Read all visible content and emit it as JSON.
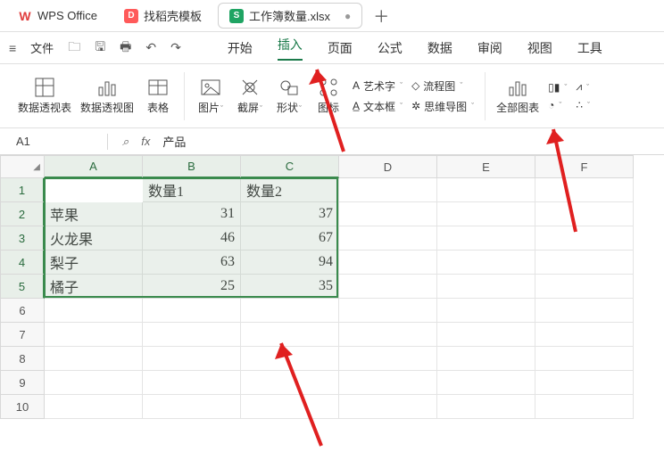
{
  "titlebar": {
    "app_name": "WPS Office",
    "template_tab": "找稻壳模板",
    "doc_tab": "工作簿数量.xlsx",
    "close_glyph": "●",
    "add_glyph": "＋"
  },
  "menurow": {
    "hamburger": "≡",
    "file_label": "文件",
    "icons": {
      "folder": "🗀",
      "save": "🖫",
      "print": "🖶",
      "undo": "↶",
      "redo": "↷"
    },
    "tabs": [
      "开始",
      "插入",
      "页面",
      "公式",
      "数据",
      "审阅",
      "视图",
      "工具"
    ],
    "active_tab": "插入"
  },
  "ribbon": {
    "pivot_table": "数据透视表",
    "pivot_chart": "数据透视图",
    "table": "表格",
    "picture": "图片",
    "screenshot": "截屏",
    "shapes": "形状",
    "iconlib": "图标",
    "wordart": "艺术字",
    "textbox": "文本框",
    "flowchart": "流程图",
    "mindmap": "思维导图",
    "all_charts": "全部图表",
    "dd": "ˇ"
  },
  "formula_bar": {
    "name_box": "A1",
    "fx": "fx",
    "value": "产品",
    "search": "⌕"
  },
  "grid": {
    "col_letters": [
      "A",
      "B",
      "C",
      "D",
      "E",
      "F"
    ],
    "row_numbers": [
      1,
      2,
      3,
      4,
      5,
      6,
      7,
      8,
      9,
      10
    ],
    "corner": "◢"
  },
  "chart_data": {
    "type": "table",
    "headers": [
      "产品",
      "数量1",
      "数量2"
    ],
    "rows": [
      [
        "苹果",
        31,
        37
      ],
      [
        "火龙果",
        46,
        67
      ],
      [
        "梨子",
        63,
        94
      ],
      [
        "橘子",
        25,
        35
      ]
    ]
  }
}
